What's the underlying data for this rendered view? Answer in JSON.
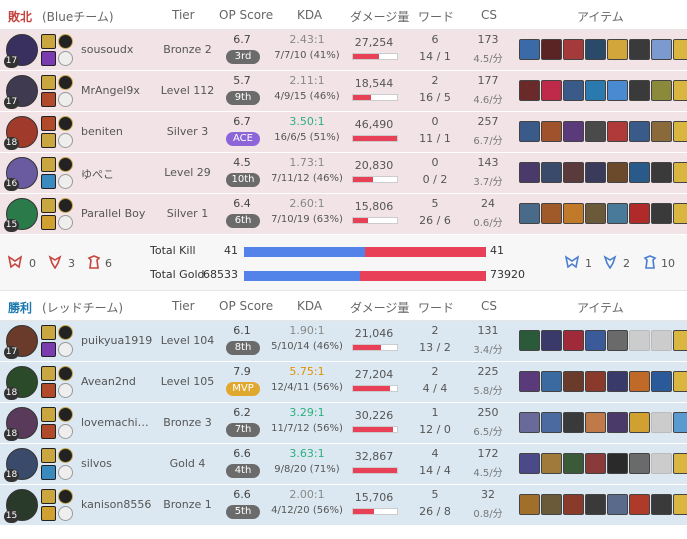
{
  "headers": {
    "tier": "Tier",
    "op_score": "OP Score",
    "kda": "KDA",
    "damage": "ダメージ量",
    "ward": "ワード",
    "cs": "CS",
    "items": "アイテム"
  },
  "blue_team": {
    "result": "敗北",
    "name": "(Blueチーム)",
    "players": [
      {
        "level": "17",
        "name": "sousoudx",
        "tier": "Bronze 2",
        "op_score": "6.7",
        "op_rank": "3rd",
        "kda_ratio": "2.43:1",
        "kda": "7/7/10 (41%)",
        "damage": "27,254",
        "damage_fraction": 0.59,
        "ward": "6",
        "ward_detail": "14 / 1",
        "cs": "173",
        "cs_per_min": "4.5/分",
        "champ_color": "#3a3060",
        "spell1": "#c9a640",
        "spell2": "#7a3ab0",
        "items": [
          "#3b6aa8",
          "#5b2424",
          "#a53a3a",
          "#2a4a6a",
          "#d2a63a",
          "#3a3a3a",
          "#7a9ad0",
          "#d9b640"
        ]
      },
      {
        "level": "17",
        "name": "MrAngel9x",
        "tier": "Level 112",
        "op_score": "5.7",
        "op_rank": "9th",
        "kda_ratio": "2.11:1",
        "kda": "4/9/15 (46%)",
        "damage": "18,544",
        "damage_fraction": 0.4,
        "ward": "2",
        "ward_detail": "16 / 5",
        "cs": "177",
        "cs_per_min": "4.6/分",
        "champ_color": "#403a50",
        "spell1": "#c9a640",
        "spell2": "#b04a2a",
        "items": [
          "#6a2a2a",
          "#c02a4a",
          "#3a5a8a",
          "#2a7ab0",
          "#4a8ad0",
          "#3a3a3a",
          "#8a8a3a",
          "#d9b640"
        ]
      },
      {
        "level": "18",
        "name": "beniten",
        "tier": "Silver 3",
        "op_score": "6.7",
        "op_rank": "ACE",
        "kda_ratio": "3.50:1",
        "kda": "16/6/5 (51%)",
        "damage": "46,490",
        "damage_fraction": 1.0,
        "ward": "0",
        "ward_detail": "11 / 1",
        "cs": "257",
        "cs_per_min": "6.7/分",
        "champ_color": "#a03a2a",
        "spell1": "#b04a2a",
        "spell2": "#c9a640",
        "items": [
          "#3a5a8a",
          "#a0522d",
          "#5a3a7a",
          "#4a4a4a",
          "#b03a3a",
          "#3a5a8a",
          "#8a6a3a",
          "#d9b640"
        ]
      },
      {
        "level": "16",
        "name": "ゆぺこ",
        "tier": "Level 29",
        "op_score": "4.5",
        "op_rank": "10th",
        "kda_ratio": "1.73:1",
        "kda": "7/11/12 (46%)",
        "damage": "20,830",
        "damage_fraction": 0.45,
        "ward": "0",
        "ward_detail": "0 / 2",
        "cs": "143",
        "cs_per_min": "3.7/分",
        "champ_color": "#6a5aa0",
        "spell1": "#c9a640",
        "spell2": "#3a8ac0",
        "items": [
          "#4a3a6a",
          "#3a4a6a",
          "#5a3a3a",
          "#3a3a5a",
          "#6a4a2a",
          "#2a5a8a",
          "#3a3a3a",
          "#d9b640"
        ]
      },
      {
        "level": "15",
        "name": "Parallel Boy",
        "tier": "Silver 1",
        "op_score": "6.4",
        "op_rank": "6th",
        "kda_ratio": "2.60:1",
        "kda": "7/10/19 (63%)",
        "damage": "15,806",
        "damage_fraction": 0.34,
        "ward": "5",
        "ward_detail": "26 / 6",
        "cs": "24",
        "cs_per_min": "0.6/分",
        "champ_color": "#2a7a4a",
        "spell1": "#c9a640",
        "spell2": "#d0a030",
        "items": [
          "#4a6a8a",
          "#a05a2a",
          "#c07a2a",
          "#6a5a3a",
          "#4a7a9a",
          "#b02a2a",
          "#3a3a3a",
          "#d9b640"
        ]
      }
    ],
    "objectives": {
      "baron": "0",
      "dragon": "3",
      "tower": "6"
    }
  },
  "summary": {
    "total_kill_label": "Total Kill",
    "total_gold_label": "Total Gold",
    "blue_kill": "41",
    "red_kill": "41",
    "blue_kill_fraction": 0.5,
    "blue_gold": "68533",
    "red_gold": "73920",
    "blue_gold_fraction": 0.48
  },
  "red_team": {
    "result": "勝利",
    "name": "(レッドチーム)",
    "players": [
      {
        "level": "17",
        "name": "puikyua1919",
        "tier": "Level 104",
        "op_score": "6.1",
        "op_rank": "8th",
        "kda_ratio": "1.90:1",
        "kda": "5/10/14 (46%)",
        "damage": "21,046",
        "damage_fraction": 0.64,
        "ward": "2",
        "ward_detail": "13 / 2",
        "cs": "131",
        "cs_per_min": "3.4/分",
        "champ_color": "#6a3a2a",
        "spell1": "#c9a640",
        "spell2": "#7a3ab0",
        "items": [
          "#2a5a3a",
          "#3a3a6a",
          "#a02a3a",
          "#3a5a9a",
          "#6a6a6a",
          "#cccccc",
          "#cccccc",
          "#d9b640"
        ]
      },
      {
        "level": "18",
        "name": "Avean2nd",
        "tier": "Level 105",
        "op_score": "7.9",
        "op_rank": "MVP",
        "kda_ratio": "5.75:1",
        "kda": "12/4/11 (56%)",
        "damage": "27,204",
        "damage_fraction": 0.83,
        "ward": "2",
        "ward_detail": "4 / 4",
        "cs": "225",
        "cs_per_min": "5.8/分",
        "champ_color": "#2a4a2a",
        "spell1": "#c9a640",
        "spell2": "#b04a2a",
        "items": [
          "#5a3a7a",
          "#3a6aa0",
          "#6a3a2a",
          "#8a3a2a",
          "#3a3a6a",
          "#c06a2a",
          "#2a5a9a",
          "#d9b640"
        ]
      },
      {
        "level": "18",
        "name": "lovemachi…",
        "tier": "Bronze 3",
        "op_score": "6.2",
        "op_rank": "7th",
        "kda_ratio": "3.29:1",
        "kda": "11/7/12 (56%)",
        "damage": "30,226",
        "damage_fraction": 0.92,
        "ward": "1",
        "ward_detail": "12 / 0",
        "cs": "250",
        "cs_per_min": "6.5/分",
        "champ_color": "#5a3a5a",
        "spell1": "#c9a640",
        "spell2": "#b04a2a",
        "items": [
          "#6a6a9a",
          "#4a6aa0",
          "#3a3a3a",
          "#c07a4a",
          "#4a3a6a",
          "#d0a030",
          "#cccccc",
          "#5a9ad0"
        ]
      },
      {
        "level": "18",
        "name": "silvos",
        "tier": "Gold 4",
        "op_score": "6.6",
        "op_rank": "4th",
        "kda_ratio": "3.63:1",
        "kda": "9/8/20 (71%)",
        "damage": "32,867",
        "damage_fraction": 1.0,
        "ward": "4",
        "ward_detail": "14 / 4",
        "cs": "172",
        "cs_per_min": "4.5/分",
        "champ_color": "#3a4a6a",
        "spell1": "#c9a640",
        "spell2": "#3a8ac0",
        "items": [
          "#4a4a8a",
          "#a07a3a",
          "#3a5a3a",
          "#8a3a3a",
          "#2a2a2a",
          "#6a6a6a",
          "#cccccc",
          "#d9b640"
        ]
      },
      {
        "level": "15",
        "name": "kanison8556",
        "tier": "Bronze 1",
        "op_score": "6.6",
        "op_rank": "5th",
        "kda_ratio": "2.00:1",
        "kda": "4/12/20 (56%)",
        "damage": "15,706",
        "damage_fraction": 0.48,
        "ward": "5",
        "ward_detail": "26 / 8",
        "cs": "32",
        "cs_per_min": "0.8/分",
        "champ_color": "#2a3a2a",
        "spell1": "#c9a640",
        "spell2": "#d0a030",
        "items": [
          "#a0702a",
          "#6a5a3a",
          "#8a3a2a",
          "#3a3a3a",
          "#5a6a8a",
          "#b03a2a",
          "#3a3a3a",
          "#d9b640"
        ]
      }
    ],
    "objectives": {
      "baron": "1",
      "dragon": "2",
      "tower": "10"
    }
  }
}
